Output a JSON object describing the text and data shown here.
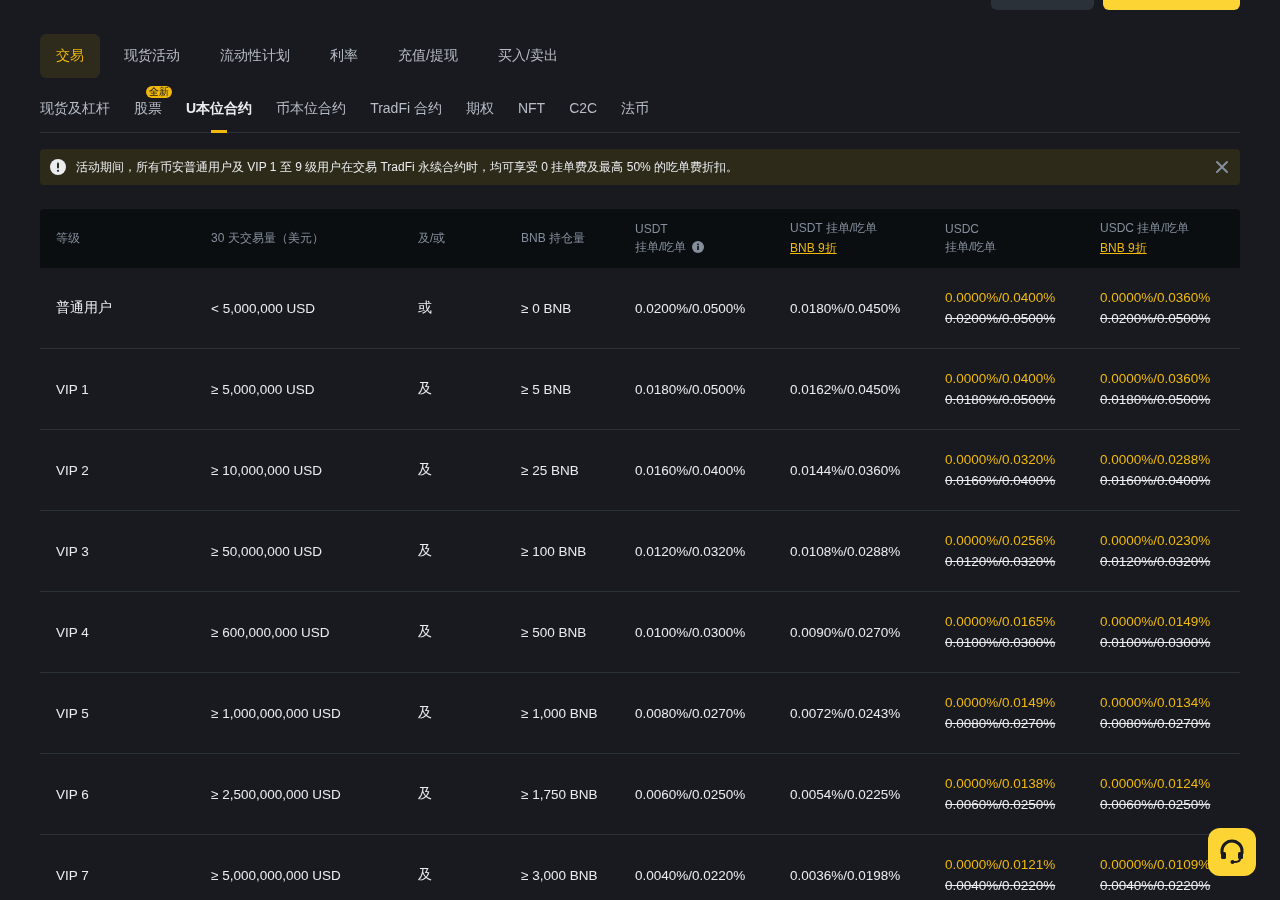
{
  "top_tabs": [
    {
      "label": "交易",
      "selected": true
    },
    {
      "label": "现货活动",
      "selected": false
    },
    {
      "label": "流动性计划",
      "selected": false
    },
    {
      "label": "利率",
      "selected": false
    },
    {
      "label": "充值/提现",
      "selected": false
    },
    {
      "label": "买入/卖出",
      "selected": false
    }
  ],
  "sub_tabs": [
    {
      "label": "现货及杠杆",
      "selected": false
    },
    {
      "label": "股票",
      "selected": false,
      "badge": "全新"
    },
    {
      "label": "U本位合约",
      "selected": true
    },
    {
      "label": "币本位合约",
      "selected": false
    },
    {
      "label": "TradFi 合约",
      "selected": false
    },
    {
      "label": "期权",
      "selected": false
    },
    {
      "label": "NFT",
      "selected": false
    },
    {
      "label": "C2C",
      "selected": false
    },
    {
      "label": "法币",
      "selected": false
    }
  ],
  "notice": {
    "text": "活动期间，所有币安普通用户及 VIP 1 至 9 级用户在交易 TradFi 永续合约时，均可享受 0 挂单费及最高 50% 的吃单费折扣。"
  },
  "table": {
    "columns": [
      {
        "label": "等级"
      },
      {
        "label": "30 天交易量（美元）"
      },
      {
        "label": "及/或"
      },
      {
        "label": "BNB 持仓量"
      },
      {
        "label": "USDT",
        "sublabel": "挂单/吃单",
        "info": true
      },
      {
        "label": "USDT 挂单/吃单",
        "link": "BNB 9折"
      },
      {
        "label": "USDC",
        "sublabel": "挂单/吃单"
      },
      {
        "label": "USDC 挂单/吃单",
        "link": "BNB 9折"
      }
    ],
    "rows": [
      {
        "level": "普通用户",
        "volume": "< 5,000,000 USD",
        "and_or": "或",
        "bnb": "≥ 0 BNB",
        "usdt": "0.0200%/0.0500%",
        "usdt_bnb": "0.0180%/0.0450%",
        "usdc": {
          "promo": "0.0000%/0.0400%",
          "original": "0.0200%/0.0500%"
        },
        "usdc_bnb": {
          "promo": "0.0000%/0.0360%",
          "original": "0.0200%/0.0500%"
        }
      },
      {
        "level": "VIP 1",
        "volume": "≥ 5,000,000 USD",
        "and_or": "及",
        "bnb": "≥ 5 BNB",
        "usdt": "0.0180%/0.0500%",
        "usdt_bnb": "0.0162%/0.0450%",
        "usdc": {
          "promo": "0.0000%/0.0400%",
          "original": "0.0180%/0.0500%"
        },
        "usdc_bnb": {
          "promo": "0.0000%/0.0360%",
          "original": "0.0180%/0.0500%"
        }
      },
      {
        "level": "VIP 2",
        "volume": "≥ 10,000,000 USD",
        "and_or": "及",
        "bnb": "≥ 25 BNB",
        "usdt": "0.0160%/0.0400%",
        "usdt_bnb": "0.0144%/0.0360%",
        "usdc": {
          "promo": "0.0000%/0.0320%",
          "original": "0.0160%/0.0400%"
        },
        "usdc_bnb": {
          "promo": "0.0000%/0.0288%",
          "original": "0.0160%/0.0400%"
        }
      },
      {
        "level": "VIP 3",
        "volume": "≥ 50,000,000 USD",
        "and_or": "及",
        "bnb": "≥ 100 BNB",
        "usdt": "0.0120%/0.0320%",
        "usdt_bnb": "0.0108%/0.0288%",
        "usdc": {
          "promo": "0.0000%/0.0256%",
          "original": "0.0120%/0.0320%"
        },
        "usdc_bnb": {
          "promo": "0.0000%/0.0230%",
          "original": "0.0120%/0.0320%"
        }
      },
      {
        "level": "VIP 4",
        "volume": "≥ 600,000,000 USD",
        "and_or": "及",
        "bnb": "≥ 500 BNB",
        "usdt": "0.0100%/0.0300%",
        "usdt_bnb": "0.0090%/0.0270%",
        "usdc": {
          "promo": "0.0000%/0.0165%",
          "original": "0.0100%/0.0300%"
        },
        "usdc_bnb": {
          "promo": "0.0000%/0.0149%",
          "original": "0.0100%/0.0300%"
        }
      },
      {
        "level": "VIP 5",
        "volume": "≥ 1,000,000,000 USD",
        "and_or": "及",
        "bnb": "≥ 1,000 BNB",
        "usdt": "0.0080%/0.0270%",
        "usdt_bnb": "0.0072%/0.0243%",
        "usdc": {
          "promo": "0.0000%/0.0149%",
          "original": "0.0080%/0.0270%"
        },
        "usdc_bnb": {
          "promo": "0.0000%/0.0134%",
          "original": "0.0080%/0.0270%"
        }
      },
      {
        "level": "VIP 6",
        "volume": "≥ 2,500,000,000 USD",
        "and_or": "及",
        "bnb": "≥ 1,750 BNB",
        "usdt": "0.0060%/0.0250%",
        "usdt_bnb": "0.0054%/0.0225%",
        "usdc": {
          "promo": "0.0000%/0.0138%",
          "original": "0.0060%/0.0250%"
        },
        "usdc_bnb": {
          "promo": "0.0000%/0.0124%",
          "original": "0.0060%/0.0250%"
        }
      },
      {
        "level": "VIP 7",
        "volume": "≥ 5,000,000,000 USD",
        "and_or": "及",
        "bnb": "≥ 3,000 BNB",
        "usdt": "0.0040%/0.0220%",
        "usdt_bnb": "0.0036%/0.0198%",
        "usdc": {
          "promo": "0.0000%/0.0121%",
          "original": "0.0040%/0.0220%"
        },
        "usdc_bnb": {
          "promo": "0.0000%/0.0109%",
          "original": "0.0040%/0.0220%"
        }
      }
    ]
  }
}
